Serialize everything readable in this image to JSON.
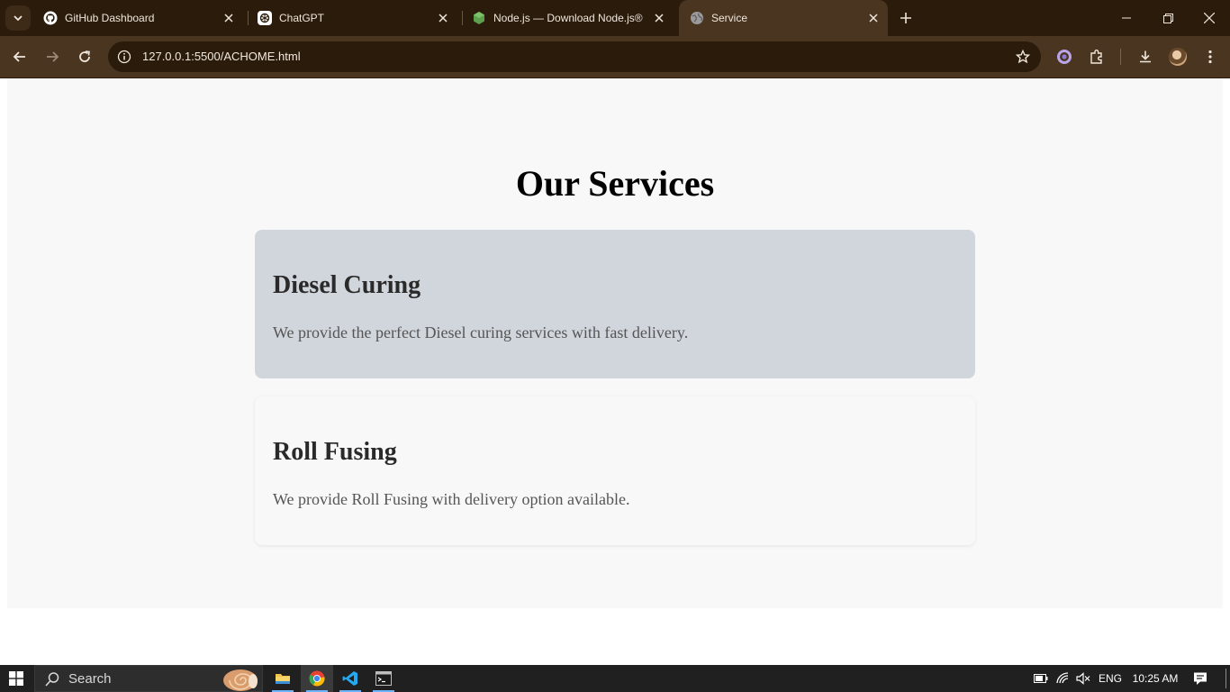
{
  "browser": {
    "tabs": [
      {
        "title": "GitHub Dashboard",
        "icon": "github-icon",
        "active": false
      },
      {
        "title": "ChatGPT",
        "icon": "chatgpt-icon",
        "active": false
      },
      {
        "title": "Node.js — Download Node.js®",
        "icon": "nodejs-icon",
        "active": false
      },
      {
        "title": "Service",
        "icon": "globe-icon",
        "active": true
      }
    ],
    "url": "127.0.0.1:5500/ACHOME.html"
  },
  "page": {
    "heading": "Our Services",
    "services": [
      {
        "title": "Diesel Curing",
        "description": "We provide the perfect Diesel curing services with fast delivery.",
        "hover_bg": "#d1d5dc"
      },
      {
        "title": "Roll Fusing",
        "description": "We provide Roll Fusing with delivery option available."
      }
    ]
  },
  "taskbar": {
    "search_label": "Search",
    "apps": [
      "file-explorer-icon",
      "chrome-icon",
      "vscode-icon",
      "terminal-icon"
    ],
    "language": "ENG",
    "time": "10:25 AM"
  },
  "colors": {
    "browser_frame": "#2b1b0b",
    "toolbar": "#4a3520",
    "page_bg": "#f8f8f8",
    "card_hover": "#d1d5dc"
  }
}
